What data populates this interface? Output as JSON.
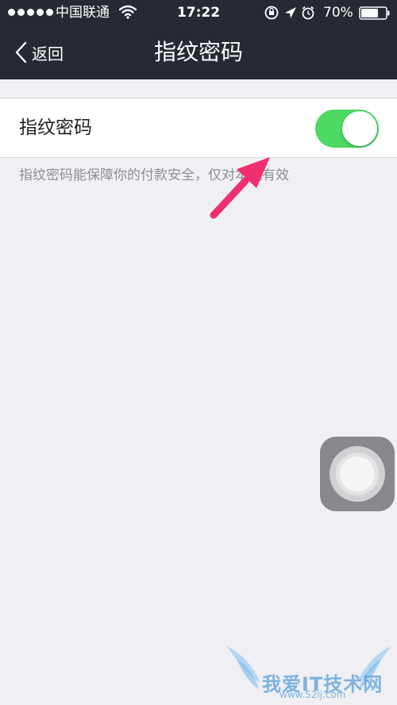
{
  "status_bar": {
    "carrier": "中国联通",
    "time": "17:22",
    "battery_percent": "70%",
    "signal_bars": 5
  },
  "nav": {
    "back_label": "返回",
    "title": "指纹密码"
  },
  "settings": {
    "fingerprint_label": "指纹密码",
    "fingerprint_enabled": true,
    "note": "指纹密码能保障你的付款安全，仅对本机有效"
  },
  "watermark": {
    "text": "我爱IT技术网",
    "url": "www.52ij.com"
  },
  "colors": {
    "nav_bg": "#262a32",
    "page_bg": "#efeff4",
    "toggle_on": "#4cd964",
    "arrow": "#f0306e"
  },
  "icons": [
    "wifi-icon",
    "orientation-lock-icon",
    "location-icon",
    "alarm-icon",
    "battery-icon",
    "back-chevron-icon",
    "assistive-touch-icon"
  ]
}
